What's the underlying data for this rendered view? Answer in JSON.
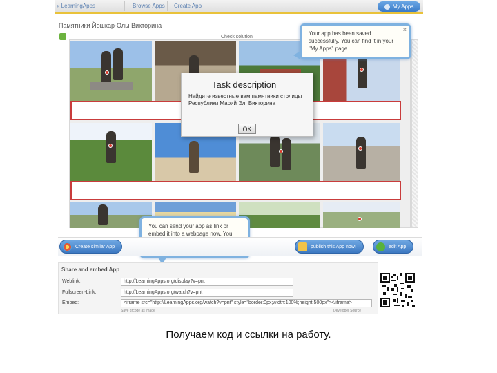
{
  "topbar": {
    "items": [
      "« LearningApps",
      "Browse Apps",
      "Create App"
    ],
    "my_apps": "My Apps"
  },
  "app": {
    "title": "Памятники Йошкар-Олы Викторина",
    "check_label": "Check solution"
  },
  "modal": {
    "title": "Task description",
    "text": "Найдите известные вам памятники столицы Республики Марий Эл. Викторина",
    "ok": "OK"
  },
  "tooltip_top": {
    "text": "Your app has been saved successfully. You can find it in your \"My Apps\" page.",
    "close": "×"
  },
  "tooltip_bottom": {
    "text": "You can send your app as link or embed it into a webpage now. You may also publish your app in the public catalog."
  },
  "actions": {
    "create_similar": "Create similar App",
    "publish": "publish this App now!",
    "edit": "edit App"
  },
  "share": {
    "heading": "Share and embed App",
    "rows": [
      {
        "label": "Weblink:",
        "value": "http://LearningApps.org/display?v=pnt"
      },
      {
        "label": "Fullscreen-Link:",
        "value": "http://LearningApps.org/watch?v=pnt"
      },
      {
        "label": "Embed:",
        "value": "<iframe src=\"http://LearningApps.org/watch?v=pnt\" style=\"border:0px;width:100%;height:500px\"></iframe>"
      }
    ],
    "note_left": "Save qrcode as image",
    "note_right": "Developer Source"
  },
  "caption": "Получаем код и ссылки на работу.",
  "colors": {
    "accent": "#3d79c2",
    "highlight_row": "#c93c3c",
    "tooltip_border": "#7fb2e0",
    "topbar_underline": "#e9c23a"
  },
  "icons": {
    "app_icon": "green-app-icon",
    "create_similar": "palette-icon",
    "publish": "pencil-icon",
    "edit": "refresh-icon"
  }
}
